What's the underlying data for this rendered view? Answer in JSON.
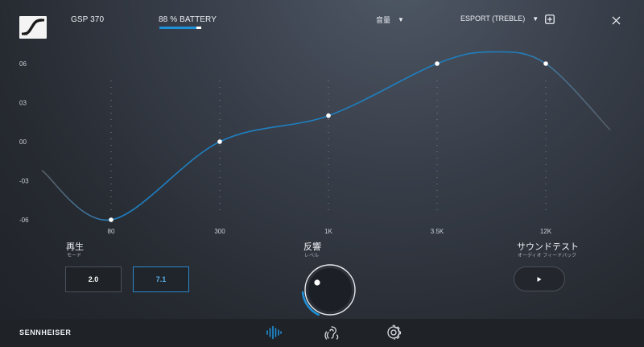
{
  "header": {
    "device_name": "GSP 370",
    "battery_label": "88 % BATTERY",
    "battery_level": 0.88,
    "volume_dropdown": "音量",
    "preset_dropdown": "ESPORT (TREBLE)"
  },
  "equalizer": {
    "y_ticks": [
      "06",
      "03",
      "00",
      "-03",
      "-06"
    ],
    "x_ticks": [
      "80",
      "300",
      "1K",
      "3.5K",
      "12K"
    ],
    "band_gains_db": [
      -6,
      0,
      2,
      6,
      6
    ],
    "curve_color": "#1e7fc0",
    "point_color": "#ffffff"
  },
  "playback": {
    "title": "再生",
    "subtitle": "モード",
    "modes": [
      "2.0",
      "7.1"
    ],
    "selected_mode": "7.1"
  },
  "reverb": {
    "title": "反響",
    "subtitle": "レベル",
    "level": 0.2
  },
  "sound_test": {
    "title": "サウンドテスト",
    "subtitle": "オーディオ フィードバック"
  },
  "footer": {
    "brand": "SENNHEISER",
    "icons": [
      "equalizer-icon",
      "surround-icon",
      "settings-icon"
    ]
  },
  "accent_color": "#1e90d8"
}
